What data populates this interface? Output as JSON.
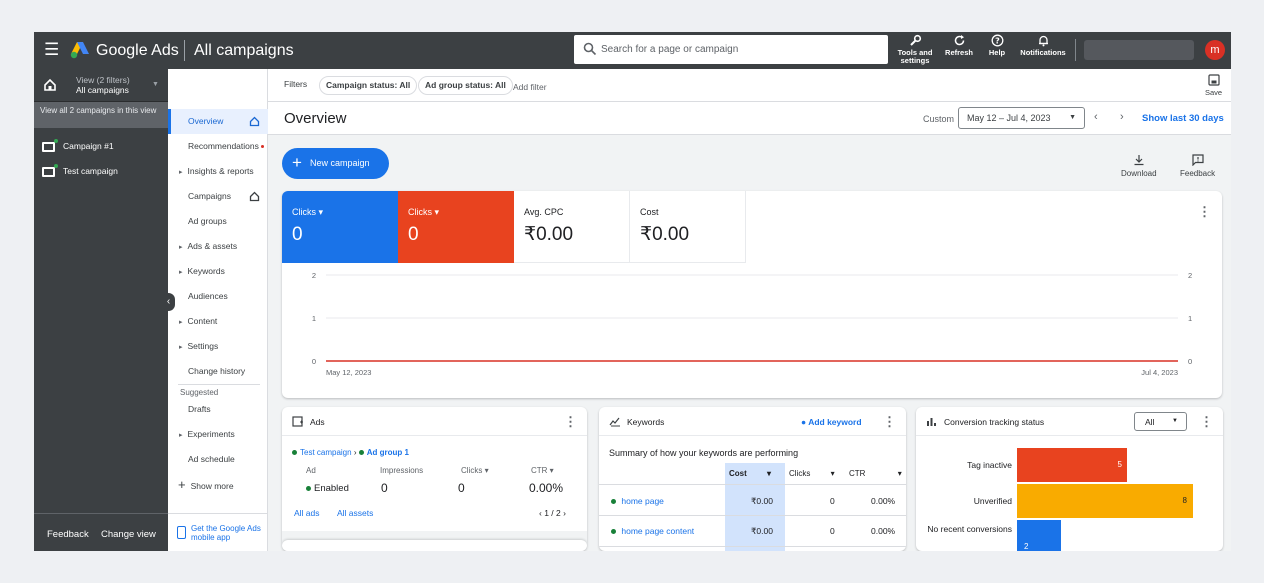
{
  "header": {
    "brand": "Google Ads",
    "title": "All campaigns",
    "search_placeholder": "Search for a page or campaign",
    "tools_label": "Tools and settings",
    "refresh_label": "Refresh",
    "help_label": "Help",
    "notifications_label": "Notifications",
    "avatar_initial": "m"
  },
  "left_panel": {
    "view_filter": "View (2 filters)",
    "view_name": "All campaigns",
    "view_all_text": "View all 2 campaigns in this view",
    "campaigns": [
      "Campaign #1",
      "Test campaign"
    ],
    "feedback": "Feedback",
    "change_view": "Change view"
  },
  "nav": {
    "items": [
      {
        "label": "Overview",
        "icon": "home-icon"
      },
      {
        "label": "Recommendations"
      },
      {
        "label": "Insights & reports"
      },
      {
        "label": "Campaigns",
        "icon": "home-icon"
      },
      {
        "label": "Ad groups"
      },
      {
        "label": "Ads & assets"
      },
      {
        "label": "Keywords"
      },
      {
        "label": "Audiences"
      },
      {
        "label": "Content"
      },
      {
        "label": "Settings"
      },
      {
        "label": "Change history"
      }
    ],
    "suggested": "Suggested",
    "suggested_items": [
      "Drafts",
      "Experiments",
      "Ad schedule"
    ],
    "show_more": "Show more",
    "app_promo": "Get the Google Ads mobile app"
  },
  "filters": {
    "label": "Filters",
    "chips": [
      "Campaign status: All",
      "Ad group status: All"
    ],
    "add_filter": "Add filter",
    "save": "Save"
  },
  "overview": {
    "title": "Overview",
    "custom": "Custom",
    "date_range": "May 12 – Jul 4, 2023",
    "show_last": "Show last 30 days",
    "new_campaign": "New campaign",
    "download": "Download",
    "feedback": "Feedback"
  },
  "metrics": [
    {
      "label": "Clicks",
      "value": "0",
      "color": "#1a73e8"
    },
    {
      "label": "Clicks",
      "value": "0",
      "color": "#e8431f"
    },
    {
      "label": "Avg. CPC",
      "value": "₹0.00"
    },
    {
      "label": "Cost",
      "value": "₹0.00"
    }
  ],
  "chart_data": {
    "type": "line",
    "x_start": "May 12, 2023",
    "x_end": "Jul 4, 2023",
    "y_ticks": [
      "2",
      "1",
      "0"
    ],
    "ylim": [
      0,
      2
    ],
    "series": [
      {
        "values": [
          0,
          0
        ],
        "color": "#d93025"
      }
    ]
  },
  "ads_card": {
    "title": "Ads",
    "breadcrumb_campaign": "Test campaign",
    "breadcrumb_adgroup": "Ad group 1",
    "headers": [
      "Ad",
      "Impressions",
      "Clicks",
      "CTR"
    ],
    "row": {
      "status": "Enabled",
      "impressions": "0",
      "clicks": "0",
      "ctr": "0.00%"
    },
    "all_ads": "All ads",
    "all_assets": "All assets",
    "pager": "1 / 2"
  },
  "keywords_card": {
    "title": "Keywords",
    "add_keyword": "Add keyword",
    "summary": "Summary of how your keywords are performing",
    "headers": [
      "Cost",
      "Clicks",
      "CTR"
    ],
    "rows": [
      {
        "keyword": "home page",
        "cost": "₹0.00",
        "clicks": "0",
        "ctr": "0.00%"
      },
      {
        "keyword": "home page content",
        "cost": "₹0.00",
        "clicks": "0",
        "ctr": "0.00%"
      }
    ]
  },
  "conversion_card": {
    "title": "Conversion tracking status",
    "filter": "All",
    "bars": [
      {
        "label": "Tag inactive",
        "value": 5,
        "color": "#e8431f"
      },
      {
        "label": "Unverified",
        "value": 8,
        "color": "#f9ab00"
      },
      {
        "label": "No recent conversions",
        "value": 2,
        "color": "#1a73e8"
      }
    ]
  }
}
